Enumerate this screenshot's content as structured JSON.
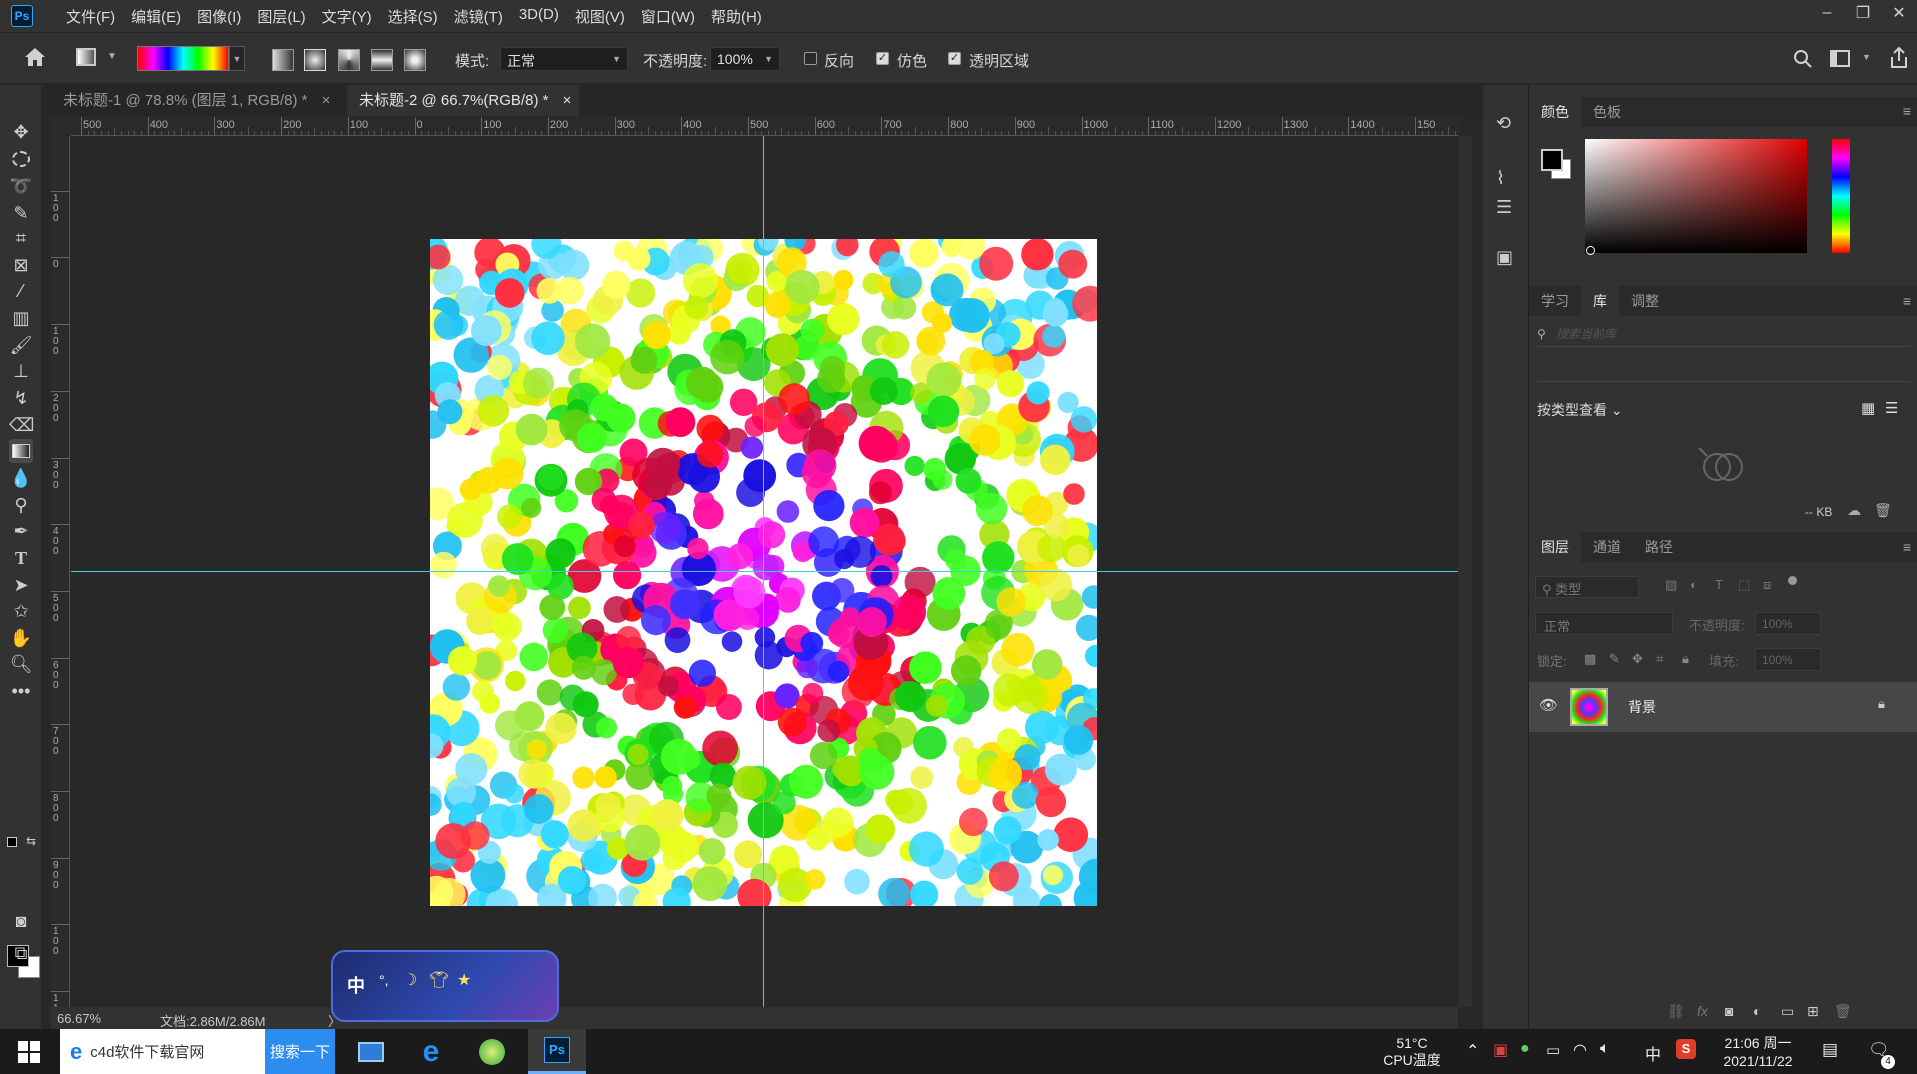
{
  "menubar": {
    "logo": "Ps",
    "items": [
      "文件(F)",
      "编辑(E)",
      "图像(I)",
      "图层(L)",
      "文字(Y)",
      "选择(S)",
      "滤镜(T)",
      "3D(D)",
      "视图(V)",
      "窗口(W)",
      "帮助(H)"
    ]
  },
  "options": {
    "mode_label": "模式:",
    "mode_value": "正常",
    "opacity_label": "不透明度:",
    "opacity_value": "100%",
    "reverse_label": "反向",
    "dither_label": "仿色",
    "transparency_label": "透明区域",
    "reverse_checked": false,
    "dither_checked": true,
    "transparency_checked": true
  },
  "tabs": [
    {
      "label": "未标题-1 @ 78.8% (图层 1, RGB/8) *",
      "close": "×"
    },
    {
      "label": "未标题-2 @ 66.7%(RGB/8) *",
      "close": "×"
    }
  ],
  "ruler_h": [
    "500",
    "400",
    "300",
    "200",
    "100",
    "0",
    "100",
    "200",
    "300",
    "400",
    "500",
    "600",
    "700",
    "800",
    "900",
    "1000",
    "1100",
    "1200",
    "1300",
    "1400",
    "150"
  ],
  "ruler_v": [
    "0",
    "1 0 0",
    "0",
    "1 0 0",
    "2 0 0",
    "3 0 0",
    "4 0 0",
    "5 0 0",
    "6 0 0",
    "7 0 0",
    "8 0 0",
    "9 0 0",
    "1 0 0",
    "1 1"
  ],
  "status": {
    "zoom": "66.67%",
    "doc": "文档:2.86M/2.86M",
    "arrow": "〉"
  },
  "color_panel": {
    "tabs": [
      "颜色",
      "色板"
    ]
  },
  "library_panel": {
    "tabs": [
      "学习",
      "库",
      "调整"
    ],
    "search_placeholder": "搜索当前库",
    "view_by": "按类型查看",
    "size": "-- KB"
  },
  "layers_panel": {
    "tabs": [
      "图层",
      "通道",
      "路径"
    ],
    "filter_placeholder": "类型",
    "blend_mode": "正常",
    "opacity_label": "不透明度:",
    "opacity_value": "100%",
    "lock_label": "锁定:",
    "fill_label": "填充:",
    "fill_value": "100%",
    "layer_name": "背景",
    "fx_label": "fx"
  },
  "taskbar": {
    "browser_title": "c4d软件下载官网",
    "search_button": "搜索一下",
    "temp": "51°C",
    "temp_label": "CPU温度",
    "ime": "中",
    "time": "21:06 周一",
    "date": "2021/11/22",
    "notif_count": "4"
  },
  "ime_widget": {
    "label": "中"
  },
  "colors": {
    "accent": "#31a8ff",
    "guide": "#3fd0e0",
    "bg": "#282828",
    "panel": "#323232"
  }
}
